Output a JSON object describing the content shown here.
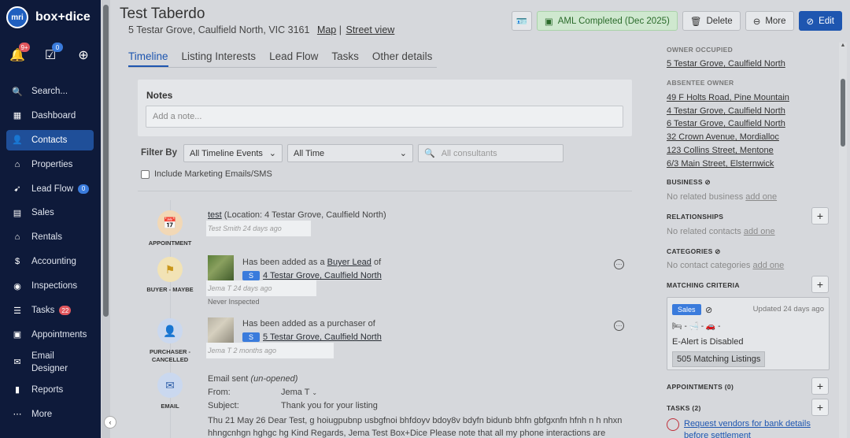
{
  "sidebar": {
    "logo_badge": "mri",
    "logo_text": "box+dice",
    "quick": {
      "notifications_badge": "9+",
      "tasks_badge": "0"
    },
    "items": [
      {
        "label": "Search...",
        "icon": "search-icon"
      },
      {
        "label": "Dashboard",
        "icon": "dashboard-icon"
      },
      {
        "label": "Contacts",
        "icon": "contacts-icon"
      },
      {
        "label": "Properties",
        "icon": "properties-icon"
      },
      {
        "label": "Lead Flow",
        "icon": "lead-flow-icon",
        "badge": "0"
      },
      {
        "label": "Sales",
        "icon": "sales-icon"
      },
      {
        "label": "Rentals",
        "icon": "rentals-icon"
      },
      {
        "label": "Accounting",
        "icon": "accounting-icon"
      },
      {
        "label": "Inspections",
        "icon": "inspections-icon"
      },
      {
        "label": "Tasks",
        "icon": "tasks-icon",
        "badge": "22"
      },
      {
        "label": "Appointments",
        "icon": "appointments-icon"
      },
      {
        "label": "Email Designer",
        "icon": "email-designer-icon"
      },
      {
        "label": "Reports",
        "icon": "reports-icon"
      },
      {
        "label": "More",
        "icon": "more-icon"
      }
    ]
  },
  "header": {
    "title": "Test Taberdo",
    "address": "5 Testar Grove, Caulfield North, VIC 3161",
    "map_link": "Map",
    "separator": "|",
    "street_view_link": "Street view",
    "aml_label": "AML Completed (Dec 2025)",
    "delete_label": "Delete",
    "more_label": "More",
    "edit_label": "Edit"
  },
  "tabs": [
    "Timeline",
    "Listing Interests",
    "Lead Flow",
    "Tasks",
    "Other details"
  ],
  "notes": {
    "heading": "Notes",
    "placeholder": "Add a note..."
  },
  "filters": {
    "label": "Filter By",
    "events": "All Timeline Events",
    "time": "All Time",
    "consultants_placeholder": "All consultants",
    "include_marketing": "Include Marketing Emails/SMS"
  },
  "timeline": [
    {
      "label": "APPOINTMENT",
      "link": "test",
      "text": "(Location: 4 Testar Grove, Caulfield North)",
      "meta": "Test Smith 24 days ago"
    },
    {
      "label": "BUYER - MAYBE",
      "text": "Has been added as a",
      "link1": "Buyer Lead",
      "text2": "of",
      "badge": "S",
      "address": "4 Testar Grove, Caulfield North",
      "meta": "Jema T 24 days ago",
      "note": "Never Inspected"
    },
    {
      "label": "PURCHASER - CANCELLED",
      "text": "Has been added as a purchaser of",
      "badge": "S",
      "address": "5 Testar Grove, Caulfield North",
      "meta": "Jema T 2 months ago"
    },
    {
      "label": "EMAIL",
      "sent": "Email sent",
      "status": "(un-opened)",
      "from_label": "From:",
      "from": "Jema T",
      "subject_label": "Subject:",
      "subject": "Thank you for your listing",
      "body": "Thu 21 May 26 Dear Test, g hoiugpubnp usbgfnoi bhfdoyv bdoy8v bdyfn bidunb bhfn gbfgxnfn hfnh n h nhxn hhngcnhgn hghgc hg Kind Regards, Jema Test Box+Dice Please note that all my phone interactions are"
    }
  ],
  "right": {
    "owner_occupied_heading": "OWNER OCCUPIED",
    "owner_occupied": [
      "5 Testar Grove, Caulfield North"
    ],
    "absentee_heading": "ABSENTEE OWNER",
    "absentee": [
      "49 F Holts Road, Pine Mountain",
      "4 Testar Grove, Caulfield North",
      "6 Testar Grove, Caulfield North",
      "32 Crown Avenue, Mordialloc",
      "123 Collins Street, Mentone",
      "6/3 Main Street, Elsternwick"
    ],
    "business_heading": "BUSINESS",
    "business_empty": "No related business",
    "business_add": "add one",
    "relationships_heading": "RELATIONSHIPS",
    "relationships_empty": "No related contacts",
    "relationships_add": "add one",
    "categories_heading": "CATEGORIES",
    "categories_empty": "No contact categories",
    "categories_add": "add one",
    "matching_heading": "MATCHING CRITERIA",
    "matching": {
      "type": "Sales",
      "updated": "Updated 24 days ago",
      "features": "🛏 -  🛁 -  🚗 -",
      "alert": "E-Alert is Disabled",
      "count": "505 Matching Listings"
    },
    "appointments_heading": "APPOINTMENTS (0)",
    "tasks_heading": "TASKS (2)",
    "task_1": "Request vendors for bank details before settlement"
  }
}
